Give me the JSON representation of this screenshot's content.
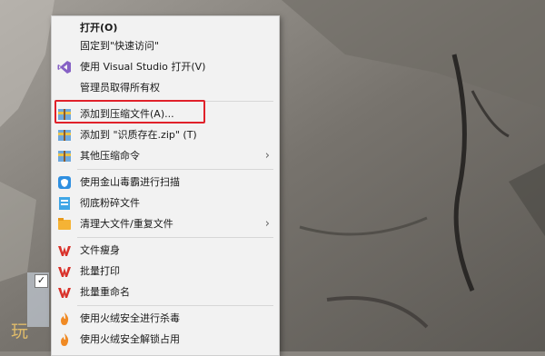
{
  "menu": {
    "items": [
      {
        "label": "打开(O)",
        "bold": true,
        "icon": "none"
      },
      {
        "label": "固定到\"快速访问\"",
        "icon": "none"
      },
      {
        "label": "使用 Visual Studio 打开(V)",
        "icon": "visual-studio-icon"
      },
      {
        "label": "管理员取得所有权",
        "icon": "none"
      },
      {
        "label": "添加到压缩文件(A)...",
        "icon": "archive-icon"
      },
      {
        "label": "添加到 \"识质存在.zip\" (T)",
        "icon": "archive-icon"
      },
      {
        "label": "其他压缩命令",
        "icon": "archive-icon",
        "submenu": true
      },
      {
        "label": "使用金山毒霸进行扫描",
        "icon": "kingsoft-scan-icon"
      },
      {
        "label": "彻底粉碎文件",
        "icon": "shred-icon"
      },
      {
        "label": "清理大文件/重复文件",
        "icon": "cleanup-icon",
        "submenu": true
      },
      {
        "label": "文件瘦身",
        "icon": "wps-icon"
      },
      {
        "label": "批量打印",
        "icon": "wps-icon"
      },
      {
        "label": "批量重命名",
        "icon": "wps-icon"
      },
      {
        "label": "使用火绒安全进行杀毒",
        "icon": "huorong-icon"
      },
      {
        "label": "使用火绒安全解锁占用",
        "icon": "huorong-icon"
      }
    ],
    "submenu_arrow": "›"
  },
  "desktop": {
    "checkbox": "✓",
    "watermark": "玩 玩"
  },
  "colors": {
    "highlight_border": "#e0212a",
    "menu_bg": "#f2f2f2",
    "vs_purple": "#8661c5",
    "wps_red": "#d9322b",
    "huorong_orange": "#f08a24",
    "kingsoft_blue": "#2f8fe0"
  }
}
